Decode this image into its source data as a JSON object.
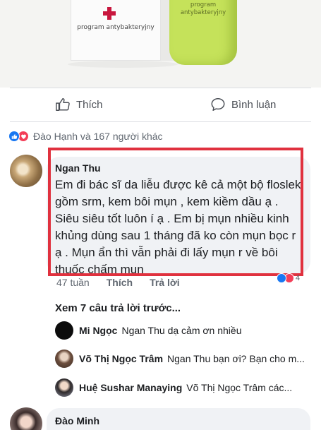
{
  "product": {
    "box_text": "program antybakteryjny",
    "tube_text": "program antybakteryjny"
  },
  "actions": {
    "like_label": "Thích",
    "comment_label": "Bình luận"
  },
  "reactions": {
    "summary": "Đào Hạnh và 167 người khác",
    "icons": [
      "like-icon",
      "heart-icon"
    ]
  },
  "comment": {
    "author": "Ngan Thu",
    "text": "Em đi bác sĩ da liễu được kê cả một bộ floslek gồm srm, kem bôi mụn , kem kiềm dầu ạ . Siêu siêu tốt luôn í ạ . Em bị mụn nhiều kinh khủng dùng sau 1 tháng đã ko còn mụn bọc r ạ . Mụn ẩn thì vẫn phải đi lấy mụn r về bôi thuốc chấm mụn",
    "time": "47 tuần",
    "like_label": "Thích",
    "reply_label": "Trả lời",
    "reaction_count": "4",
    "highlight_color": "#e0313e"
  },
  "replies": {
    "more_label": "Xem 7 câu trả lời trước...",
    "items": [
      {
        "author": "Mi Ngọc",
        "text": "Ngan Thu  dạ cảm ơn nhiều"
      },
      {
        "author": "Võ Thị Ngọc Trâm",
        "text": "Ngan Thu bạn ơi? Bạn cho m..."
      },
      {
        "author": "Huệ Sushar Manaying",
        "text": "Võ Thị Ngọc Trâm  các..."
      }
    ]
  },
  "next_comment": {
    "author": "Đào Minh"
  },
  "colors": {
    "like_blue": "#1877f2",
    "heart_red": "#f33e58",
    "bubble_bg": "#f0f2f5"
  }
}
